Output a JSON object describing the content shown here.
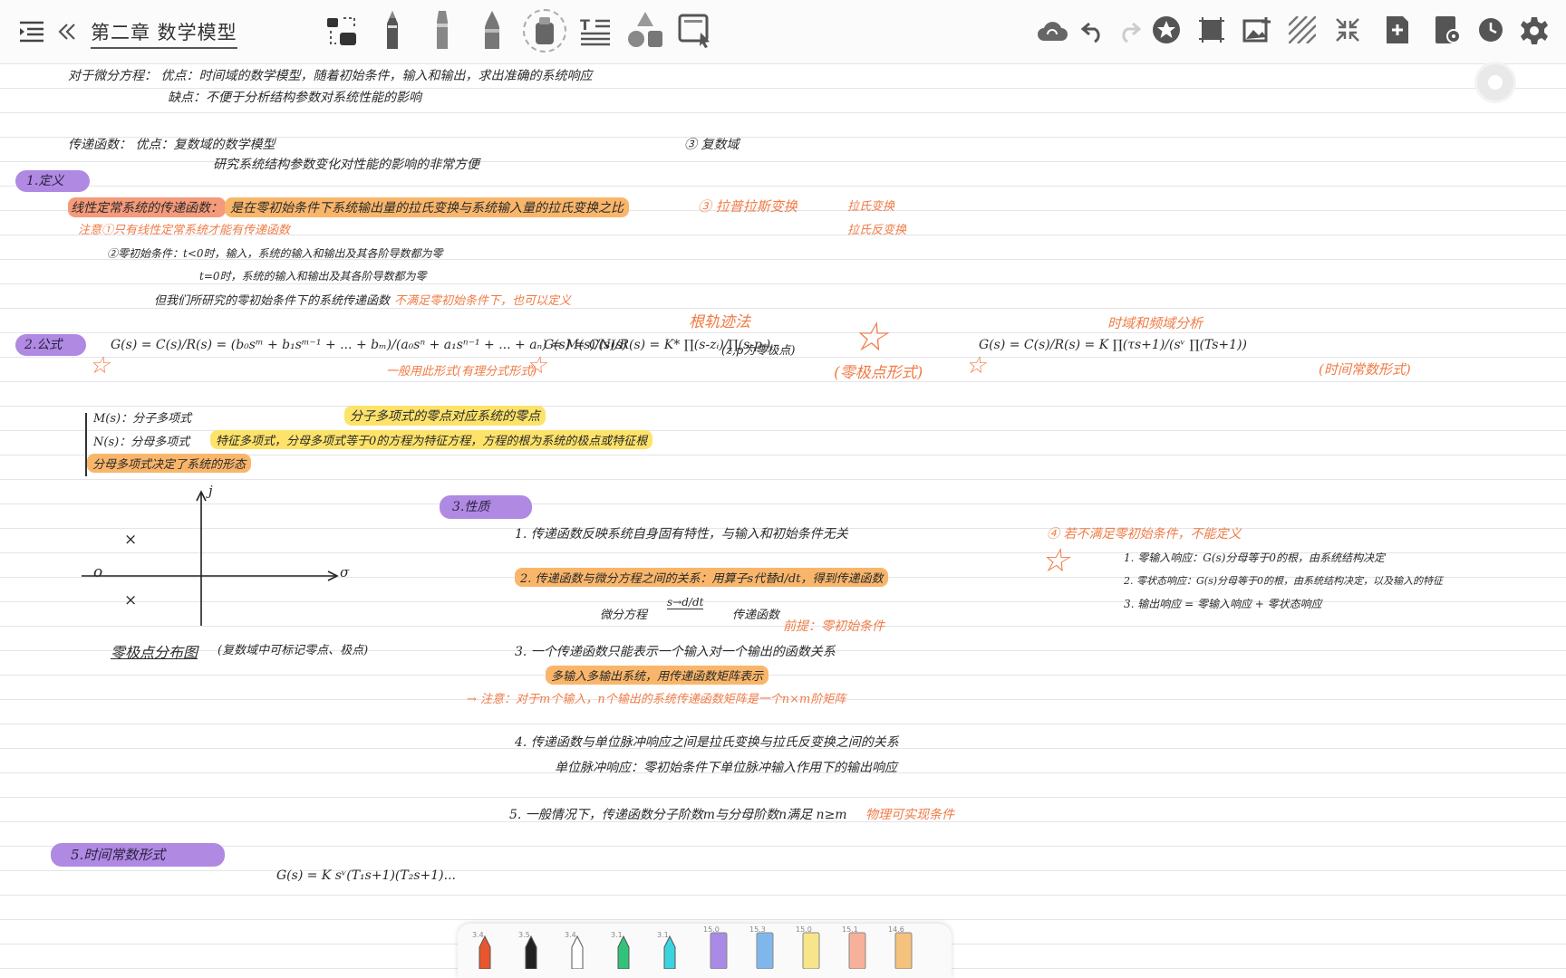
{
  "toolbar": {
    "outline_icon": "outline-toggle-icon",
    "back_icon": "double-chevron-left-icon",
    "title": "第二章 数学模型",
    "tools": [
      "lasso-tool",
      "pen-tool",
      "marker-tool",
      "highlighter-tool",
      "eraser-tool",
      "text-tool",
      "shapes-tool",
      "image-select-tool"
    ],
    "right_tools": [
      "cloud-sync-icon",
      "undo-icon",
      "redo-icon",
      "star-icon",
      "crop-icon",
      "insert-image-icon",
      "pattern-icon",
      "shrink-icon",
      "add-page-icon",
      "notebook-icon",
      "clock-icon",
      "settings-icon"
    ]
  },
  "notes": {
    "l1": "对于微分方程： 优点：时间域的数学模型，随着初始条件，输入和输出，求出准确的系统响应",
    "l2": "缺点：不便于分析结构参数对系统性能的影响",
    "l3": "传递函数： 优点：复数域的数学模型",
    "l3b": "③ 复数域",
    "l4": "研究系统结构参数变化对性能的影响的非常方便",
    "def_tag": "1.定义",
    "def1": "线性定常系统的传递函数：",
    "def1b": "是在零初始条件下系统输出量的拉氏变换与系统输入量的拉氏变换之比",
    "def_note": "注意①只有线性定常系统才能有传递函数",
    "def_side1": "③ 拉普拉斯变换",
    "def_side2": "拉氏变换",
    "def_side3": "拉氏反变换",
    "zero1": "②零初始条件：t<0时，输入，系统的输入和输出及其各阶导数都为零",
    "zero2": "t=0时，系统的输入和输出及其各阶导数都为零",
    "zero3": "但我们所研究的零初始条件下的系统传递函数",
    "zero3b": "不满足零初始条件下，也可以定义",
    "formula_tag": "2.公式",
    "f1_lhs": "G(s) = C(s)/R(s) = (b₀sᵐ + b₁sᵐ⁻¹ + ... + bₘ)/(a₀sⁿ + a₁sⁿ⁻¹ + ... + aₙ) = M(s)/N(s)",
    "f1_note": "一般用此形式(有理分式形式)",
    "f2_lhs": "G(s) = C(s)/R(s) = K* ∏(s-zᵢ)/∏(s-pⱼ)",
    "f2_note": "(z,p为零极点)",
    "f2_tag": "(零极点形式)",
    "f2_title": "根轨迹法",
    "f3_title": "时域和频域分析",
    "f3_lhs": "G(s) = C(s)/R(s) = K ∏(τs+1)/(sᵛ ∏(Ts+1))",
    "f3_tag": "(时间常数形式)",
    "ms1": "M(s)：分子多项式",
    "ms_note": "分子多项式的零点对应系统的零点",
    "ns1": "N(s)：分母多项式",
    "ns_note": "特征多项式，分母多项式等于0的方程为特征方程，方程的根为系统的极点或特征根",
    "ms_note2": "分母多项式决定了系统的形态",
    "pz_label": "零极点分布图",
    "pz_note": "(复数域中可标记零点、极点)",
    "prop_tag": "3.性质",
    "p1": "1. 传递函数反映系统自身固有特性，与输入和初始条件无关",
    "p2": "2. 传递函数与微分方程之间的关系：用算子s代替d/dt，得到传递函数",
    "p2b": "微分方程",
    "p2c": "s→d/dt",
    "p2d": "传递函数",
    "p2e": "前提：零初始条件",
    "p3": "3. 一个传递函数只能表示一个输入对一个输出的函数关系",
    "p3b": "多输入多输出系统，用传递函数矩阵表示",
    "p3c": "→ 注意：对于m个输入，n个输出的系统传递函数矩阵是一个n×m阶矩阵",
    "p4": "4. 传递函数与单位脉冲响应之间是拉氏变换与拉氏反变换之间的关系",
    "p4b": "单位脉冲响应：零初始条件下单位脉冲输入作用下的输出响应",
    "p5": "5. 一般情况下，传递函数分子阶数m与分母阶数n满足 n≥m",
    "p5b": "物理可实现条件",
    "side_title": "④ 若不满足零初始条件，不能定义",
    "side1": "1. 零输入响应：G(s)分母等于0的根，由系统结构决定",
    "side2": "2. 零状态响应：G(s)分母等于0的根，由系统结构决定，以及输入的特征",
    "side3": "3. 输出响应 = 零输入响应 + 零状态响应",
    "bottom_tag": "5.时间常数形式",
    "bottom_f": "G(s) = K sᵛ(T₁s+1)(T₂s+1)...",
    "axis_j": "j",
    "axis_sigma": "σ",
    "pole_mark": "×",
    "zero_mark": "o"
  },
  "pens": [
    {
      "size": "3.4",
      "color": "#e8562e"
    },
    {
      "size": "3.5",
      "color": "#222222"
    },
    {
      "size": "3.4",
      "color": "#ffffff"
    },
    {
      "size": "3.1",
      "color": "#33c27a"
    },
    {
      "size": "3.1",
      "color": "#3ad3e0"
    },
    {
      "size": "15.0",
      "color": "#a98ae6"
    },
    {
      "size": "15.3",
      "color": "#7fb7ec"
    },
    {
      "size": "15.0",
      "color": "#f6e58a"
    },
    {
      "size": "15.1",
      "color": "#f7b09a"
    },
    {
      "size": "14.6",
      "color": "#f4c27d"
    }
  ],
  "colors": {
    "accent_purple": "#b089e3",
    "ink_orange": "#ef7b45",
    "highlight_yellow": "#fde36a",
    "highlight_orange": "#f9b66b"
  }
}
